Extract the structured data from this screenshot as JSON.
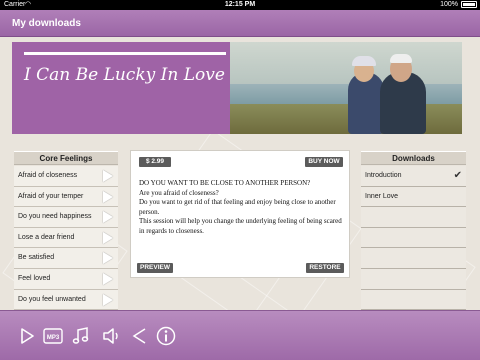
{
  "status_bar": {
    "carrier": "Carrier",
    "time": "12:15 PM",
    "battery": "100%"
  },
  "nav": {
    "title": "My downloads"
  },
  "banner": {
    "title": "I Can Be Lucky In Love"
  },
  "core_feelings": {
    "title": "Core Feelings",
    "items": [
      "Afraid of closeness",
      "Afraid of your temper",
      "Do you need happiness",
      "Lose a dear friend",
      "Be satisfied",
      "Feel loved",
      "Do you feel unwanted"
    ]
  },
  "product": {
    "price": "$ 2.99",
    "buy_label": "BUY NOW",
    "description": [
      "DO YOU WANT TO BE CLOSE TO ANOTHER PERSON?",
      "Are you afraid of closeness?",
      "Do you want to get rid of that feeling and enjoy being close to another person.",
      "This session will help you change the underlying feeling of being scared in regards to closeness."
    ],
    "preview_label": "PREVIEW",
    "restore_label": "RESTORE"
  },
  "downloads": {
    "title": "Downloads",
    "items": [
      {
        "label": "Introduction",
        "checked": true
      },
      {
        "label": "Inner Love",
        "checked": false
      },
      {
        "label": "",
        "checked": false
      },
      {
        "label": "",
        "checked": false
      },
      {
        "label": "",
        "checked": false
      },
      {
        "label": "",
        "checked": false
      },
      {
        "label": "",
        "checked": false
      }
    ]
  },
  "toolbar": {
    "icons": [
      "play-icon",
      "mp3-icon",
      "music-note-icon",
      "speaker-icon",
      "share-icon",
      "info-icon"
    ],
    "mp3_text": "MP3"
  },
  "colors": {
    "accent": "#9e6aa8",
    "banner": "#9f63a6",
    "background": "#e9e4dc"
  }
}
